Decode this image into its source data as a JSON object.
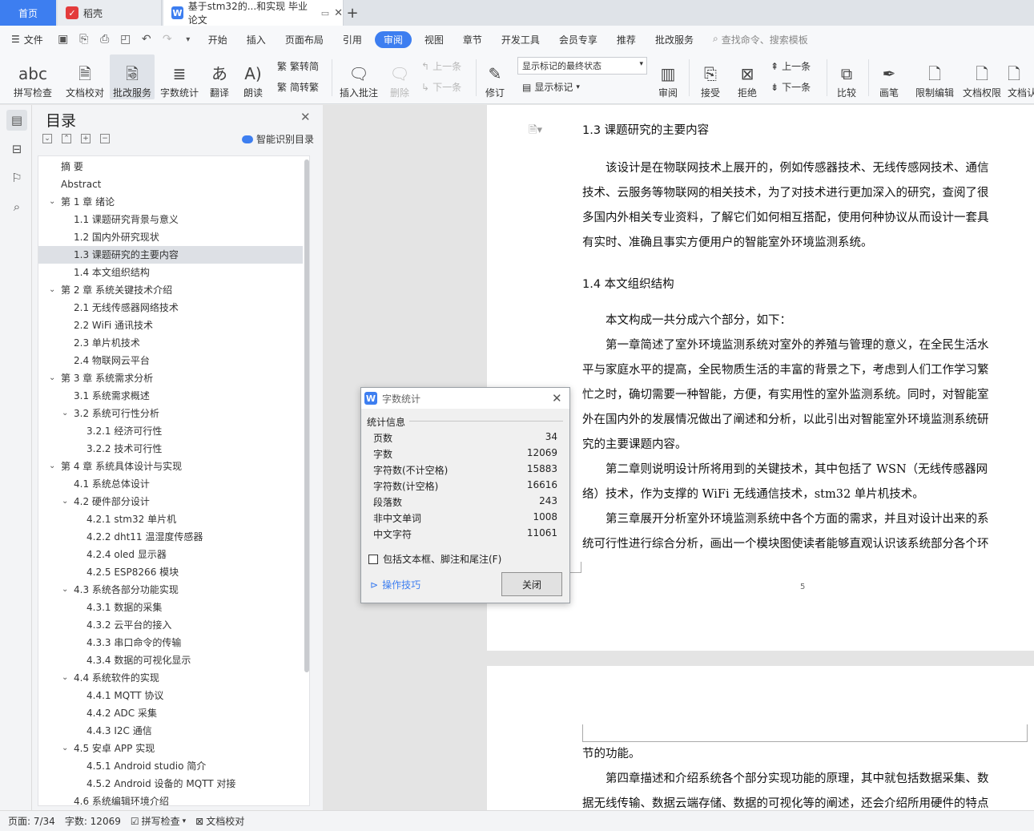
{
  "tabs": {
    "home": "首页",
    "daoke": "稻壳",
    "doc": "基于stm32的...和实现 毕业论文"
  },
  "menu": {
    "file": "文件",
    "items": [
      "开始",
      "插入",
      "页面布局",
      "引用",
      "审阅",
      "视图",
      "章节",
      "开发工具",
      "会员专享",
      "推荐",
      "批改服务"
    ],
    "active": "审阅",
    "search": "查找命令、搜索模板"
  },
  "toolbar": {
    "spell": "拼写检查",
    "doccheck": "文档校对",
    "correct": "批改服务",
    "wordcount": "字数统计",
    "translate": "翻译",
    "read": "朗读",
    "trad": "繁转简",
    "simp": "简转繁",
    "insert_comment": "插入批注",
    "delete": "删除",
    "prev_comment": "上一条",
    "next_comment": "下一条",
    "revise": "修订",
    "state_select": "显示标记的最终状态",
    "show_marks": "显示标记",
    "review": "审阅",
    "accept": "接受",
    "reject": "拒绝",
    "prev": "上一条",
    "next": "下一条",
    "compare": "比较",
    "pen": "画笔",
    "restrict": "限制编辑",
    "doc_rights": "文档权限",
    "doc_more": "文档认"
  },
  "nav": {
    "title": "目录",
    "smart": "智能识别目录",
    "items": [
      {
        "label": "摘  要",
        "level": 1,
        "chev": false
      },
      {
        "label": "Abstract",
        "level": 1,
        "chev": false
      },
      {
        "label": "第 1 章  绪论",
        "level": 1,
        "chev": true
      },
      {
        "label": "1.1  课题研究背景与意义",
        "level": 2,
        "chev": false
      },
      {
        "label": "1.2  国内外研究现状",
        "level": 2,
        "chev": false
      },
      {
        "label": "1.3  课题研究的主要内容",
        "level": 2,
        "chev": false,
        "selected": true
      },
      {
        "label": "1.4  本文组织结构",
        "level": 2,
        "chev": false
      },
      {
        "label": "第 2 章  系统关键技术介绍",
        "level": 1,
        "chev": true
      },
      {
        "label": "2.1  无线传感器网络技术",
        "level": 2,
        "chev": false
      },
      {
        "label": "2.2 WiFi 通讯技术",
        "level": 2,
        "chev": false
      },
      {
        "label": "2.3  单片机技术",
        "level": 2,
        "chev": false
      },
      {
        "label": "2.4  物联网云平台",
        "level": 2,
        "chev": false
      },
      {
        "label": "第 3 章  系统需求分析",
        "level": 1,
        "chev": true
      },
      {
        "label": "3.1  系统需求概述",
        "level": 2,
        "chev": false
      },
      {
        "label": "3.2  系统可行性分析",
        "level": 2,
        "chev": true
      },
      {
        "label": "3.2.1  经济可行性",
        "level": 3,
        "chev": false
      },
      {
        "label": "3.2.2  技术可行性",
        "level": 3,
        "chev": false
      },
      {
        "label": "第 4 章  系统具体设计与实现",
        "level": 1,
        "chev": true
      },
      {
        "label": "4.1  系统总体设计",
        "level": 2,
        "chev": false
      },
      {
        "label": "4.2  硬件部分设计",
        "level": 2,
        "chev": true
      },
      {
        "label": "4.2.1 stm32 单片机",
        "level": 3,
        "chev": false
      },
      {
        "label": "4.2.2 dht11 温湿度传感器",
        "level": 3,
        "chev": false
      },
      {
        "label": "4.2.4 oled 显示器",
        "level": 3,
        "chev": false
      },
      {
        "label": "4.2.5 ESP8266 模块",
        "level": 3,
        "chev": false
      },
      {
        "label": "4.3  系统各部分功能实现",
        "level": 2,
        "chev": true
      },
      {
        "label": "4.3.1 数据的采集",
        "level": 3,
        "chev": false
      },
      {
        "label": "4.3.2 云平台的接入",
        "level": 3,
        "chev": false
      },
      {
        "label": "4.3.3  串口命令的传输",
        "level": 3,
        "chev": false
      },
      {
        "label": "4.3.4 数据的可视化显示",
        "level": 3,
        "chev": false
      },
      {
        "label": "4.4  系统软件的实现",
        "level": 2,
        "chev": true
      },
      {
        "label": "4.4.1 MQTT 协议",
        "level": 3,
        "chev": false
      },
      {
        "label": "4.4.2 ADC 采集",
        "level": 3,
        "chev": false
      },
      {
        "label": "4.4.3 I2C 通信",
        "level": 3,
        "chev": false
      },
      {
        "label": "4.5  安卓 APP 实现",
        "level": 2,
        "chev": true
      },
      {
        "label": "4.5.1 Android studio 简介",
        "level": 3,
        "chev": false
      },
      {
        "label": "4.5.2 Android 设备的 MQTT 对接",
        "level": 3,
        "chev": false
      },
      {
        "label": "4.6  系统编辑环境介绍",
        "level": 2,
        "chev": false
      }
    ]
  },
  "doc": {
    "heading13": "1.3  课题研究的主要内容",
    "p1": [
      "　　该设计是在物联网技术上展开的，例如传感器技术、无线传感网技术、通信",
      "技术、云服务等物联网的相关技术，为了对技术进行更加深入的研究，查阅了很",
      "多国内外相关专业资料，了解它们如何相互搭配，使用何种协议从而设计一套具",
      "有实时、准确且事实方便用户的智能室外环境监测系统。"
    ],
    "heading14": "1.4  本文组织结构",
    "p2": [
      "　　本文构成一共分成六个部分，如下：",
      "　　第一章简述了室外环境监测系统对室外的养殖与管理的意义，在全民生活水",
      "平与家庭水平的提高，全民物质生活的丰富的背景之下，考虑到人们工作学习繁",
      "忙之时，确切需要一种智能，方便，有实用性的室外监测系统。同时，对智能室",
      "外在国内外的发展情况做出了阐述和分析，以此引出对智能室外环境监测系统研",
      "究的主要课题内容。",
      "　　第二章则说明设计所将用到的关键技术，其中包括了 WSN（无线传感器网",
      "络）技术，作为支撑的 WiFi 无线通信技术，stm32 单片机技术。",
      "　　第三章展开分析室外环境监测系统中各个方面的需求，并且对设计出来的系",
      "统可行性进行综合分析，画出一个模块图使读者能够直观认识该系统部分各个环"
    ],
    "page_number": "5",
    "p3": [
      "节的功能。",
      "　　第四章描述和介绍系统各个部分实现功能的原理，其中就包括数据采集、数",
      "据无线传输、数据云端存储、数据的可视化等的阐述，还会介绍所用硬件的特点"
    ]
  },
  "dialog": {
    "title": "字数统计",
    "section": "统计信息",
    "rows": [
      {
        "label": "页数",
        "value": "34"
      },
      {
        "label": "字数",
        "value": "12069"
      },
      {
        "label": "字符数(不计空格)",
        "value": "15883"
      },
      {
        "label": "字符数(计空格)",
        "value": "16616"
      },
      {
        "label": "段落数",
        "value": "243"
      },
      {
        "label": "非中文单词",
        "value": "1008"
      },
      {
        "label": "中文字符",
        "value": "11061"
      }
    ],
    "checkbox": "包括文本框、脚注和尾注(F)",
    "tips": "操作技巧",
    "close": "关闭"
  },
  "status": {
    "page": "页面: 7/34",
    "words": "字数: 12069",
    "spell": "拼写检查",
    "doccheck": "文档校对"
  },
  "colors": {
    "accent": "#3d7ef0",
    "wps_red": "#e33b3b"
  }
}
